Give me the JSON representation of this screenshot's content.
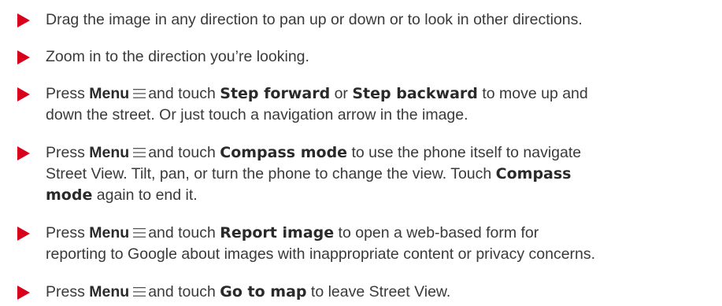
{
  "items": [
    {
      "text": "Drag the image in any direction to pan up or down or to look in other directions."
    },
    {
      "text": "Zoom in to the direction you’re looking."
    },
    {
      "prefix": "Press ",
      "menu": "Menu",
      "mid": "and touch ",
      "bold1": "Step forward",
      "or": " or ",
      "bold2": "Step backward",
      "line1_end": " to move up and",
      "line2": "down the street. Or just touch a navigation arrow in the image."
    },
    {
      "prefix": "Press ",
      "menu": "Menu",
      "mid": "and touch ",
      "bold1": "Compass mode",
      "line1_end": " to use the phone itself to navigate",
      "line2": "Street View. Tilt, pan, or turn the phone to change the view. Touch ",
      "bold2": "Compass",
      "bold3": "mode",
      "line3_end": " again to end it."
    },
    {
      "prefix": "Press ",
      "menu": "Menu",
      "mid": "and touch ",
      "bold1": "Report image",
      "line1_end": " to open a web-based form for",
      "line2": "reporting to Google about images with inappropriate content or privacy concerns."
    },
    {
      "prefix": "Press ",
      "menu": "Menu",
      "mid": "and touch ",
      "bold1": "Go to map",
      "line1_end": " to leave Street View."
    }
  ],
  "colors": {
    "bullet": "#d9001b",
    "text": "#3a3a3a"
  },
  "icons": {
    "bullet": "red-triangle-bullet-icon",
    "menu": "menu-lines-icon"
  }
}
